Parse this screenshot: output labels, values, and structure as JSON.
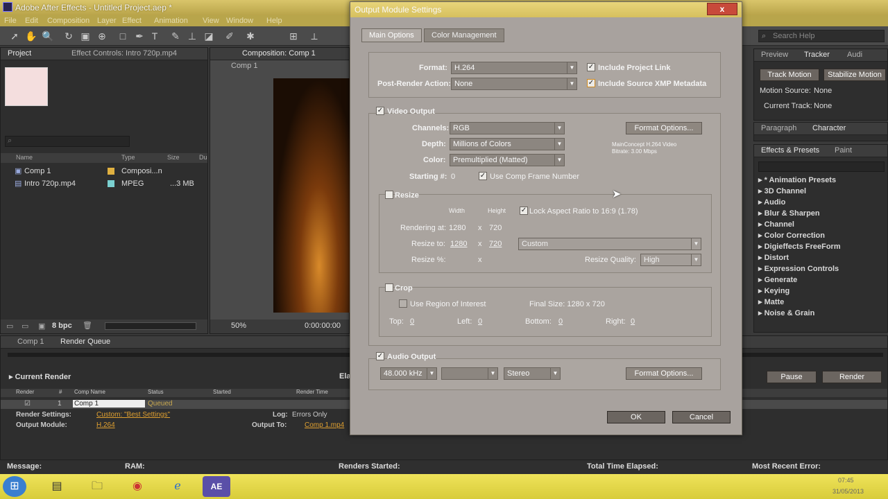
{
  "window": {
    "title": "Adobe After Effects - Untitled Project.aep *"
  },
  "menu": [
    "File",
    "Edit",
    "Composition",
    "Layer",
    "Effect",
    "Animation",
    "View",
    "Window",
    "Help"
  ],
  "help_search_placeholder": "Search Help",
  "project_panel": {
    "tab_project": "Project",
    "tab_effect_controls": "Effect Controls: Intro 720p.mp4",
    "columns": [
      "Name",
      "Type",
      "Size",
      "Du"
    ],
    "items": [
      {
        "name": "Comp 1",
        "type": "Composi...n",
        "size": ""
      },
      {
        "name": "Intro 720p.mp4",
        "type": "MPEG",
        "size": "...3 MB"
      }
    ],
    "bpc": "8 bpc"
  },
  "comp_panel": {
    "tab": "Composition: Comp 1",
    "breadcrumb": "Comp 1",
    "zoom": "50%",
    "timecode": "0:00:00:00"
  },
  "right_panel": {
    "tabs_top": [
      "Preview",
      "Tracker",
      "Audi"
    ],
    "track_motion": "Track Motion",
    "stabilize_motion": "Stabilize Motion",
    "motion_source_label": "Motion Source:",
    "motion_source_value": "None",
    "current_track_label": "Current Track:",
    "current_track_value": "None",
    "tabs_mid": [
      "Paragraph",
      "Character"
    ],
    "tabs_fx": [
      "Effects & Presets",
      "Paint"
    ],
    "effects": [
      "* Animation Presets",
      "3D Channel",
      "Audio",
      "Blur & Sharpen",
      "Channel",
      "Color Correction",
      "Digieffects FreeForm",
      "Distort",
      "Expression Controls",
      "Generate",
      "Keying",
      "Matte",
      "Noise & Grain"
    ]
  },
  "render_queue": {
    "tab_comp": "Comp 1",
    "tab_rq": "Render Queue",
    "current_render": "Current Render",
    "elapsed_prefix": "Ela",
    "pause": "Pause",
    "render": "Render",
    "columns": [
      "Render",
      "#",
      "Comp Name",
      "Status",
      "Started",
      "Render Time"
    ],
    "row": {
      "num": "1",
      "comp": "Comp 1",
      "status": "Queued"
    },
    "render_settings_label": "Render Settings:",
    "render_settings_value": "Custom: \"Best Settings\"",
    "output_module_label": "Output Module:",
    "output_module_value": "H.264",
    "log_label": "Log:",
    "log_value": "Errors Only",
    "output_to_label": "Output To:",
    "output_to_value": "Comp 1.mp4"
  },
  "status_bar": {
    "message": "Message:",
    "ram": "RAM:",
    "renders_started": "Renders Started:",
    "total_time": "Total Time Elapsed:",
    "recent_error": "Most Recent Error:"
  },
  "dialog": {
    "title": "Output Module Settings",
    "close": "x",
    "tab_main": "Main Options",
    "tab_color": "Color Management",
    "format_label": "Format:",
    "format_value": "H.264",
    "post_render_label": "Post-Render Action:",
    "post_render_value": "None",
    "include_project_link": "Include Project Link",
    "include_xmp": "Include Source XMP Metadata",
    "video_output": "Video Output",
    "channels_label": "Channels:",
    "channels_value": "RGB",
    "depth_label": "Depth:",
    "depth_value": "Millions of Colors",
    "color_label": "Color:",
    "color_value": "Premultiplied (Matted)",
    "starting_label": "Starting #:",
    "starting_value": "0",
    "use_comp_frame": "Use Comp Frame Number",
    "format_options": "Format Options...",
    "codec_info_1": "MainConcept H.264 Video",
    "codec_info_2": "Bitrate: 3.00 Mbps",
    "resize": "Resize",
    "width_label": "Width",
    "height_label": "Height",
    "lock_aspect": "Lock Aspect Ratio to 16:9 (1.78)",
    "rendering_at_label": "Rendering at:",
    "rendering_w": "1280",
    "rendering_x": "x",
    "rendering_h": "720",
    "resize_to_label": "Resize to:",
    "resize_w": "1280",
    "resize_h": "720",
    "resize_preset": "Custom",
    "resize_pct_label": "Resize %:",
    "resize_pct_x": "x",
    "resize_quality_label": "Resize Quality:",
    "resize_quality_value": "High",
    "crop": "Crop",
    "use_roi": "Use Region of Interest",
    "final_size": "Final Size: 1280 x 720",
    "top_label": "Top:",
    "top_value": "0",
    "left_label": "Left:",
    "left_value": "0",
    "bottom_label": "Bottom:",
    "bottom_value": "0",
    "right_label": "Right:",
    "right_value": "0",
    "audio_output": "Audio Output",
    "audio_rate": "48.000 kHz",
    "audio_channels": "Stereo",
    "audio_format_options": "Format Options...",
    "ok": "OK",
    "cancel": "Cancel"
  },
  "taskbar": {
    "clock_time": "07:45",
    "clock_date": "31/05/2013"
  }
}
